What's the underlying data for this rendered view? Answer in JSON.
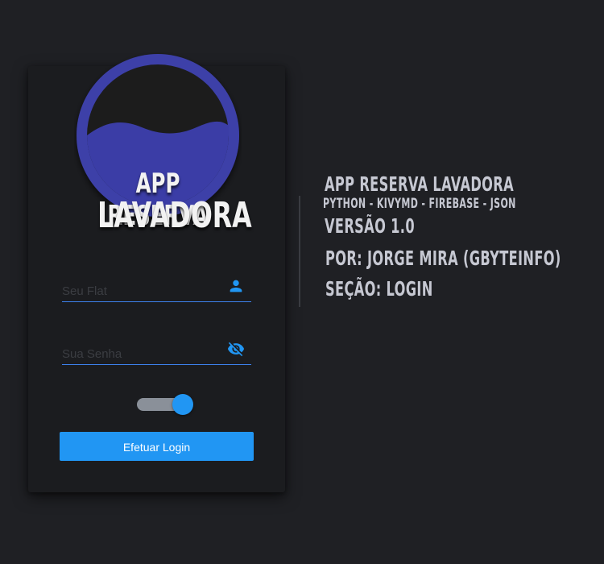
{
  "logo": {
    "line1": "APP RESERVA",
    "line2": "LAVADORA",
    "colors": {
      "ring": "#3d3fa8",
      "water": "#3b3ea6",
      "inner": "#1b1c1f"
    }
  },
  "login": {
    "flat_placeholder": "Seu Flat",
    "flat_value": "",
    "flat_icon": "account-icon",
    "password_placeholder": "Sua Senha",
    "password_value": "",
    "password_icon": "eye-off-icon",
    "remember_toggle_on": true,
    "submit_label": "Efetuar Login"
  },
  "info": {
    "title": "APP RESERVA LAVADORA",
    "stack": "PYTHON - KIVYMD - FIREBASE - JSON",
    "version": "VERSÃO 1.0",
    "author": "POR: JORGE MIRA (GBYTEINFO)",
    "section": "SEÇÃO: LOGIN"
  },
  "colors": {
    "background": "#1f2024",
    "card": "#1b1c1f",
    "accent": "#2196f3",
    "field_line": "#3d82ee",
    "info_text": "#c6c8d2"
  }
}
